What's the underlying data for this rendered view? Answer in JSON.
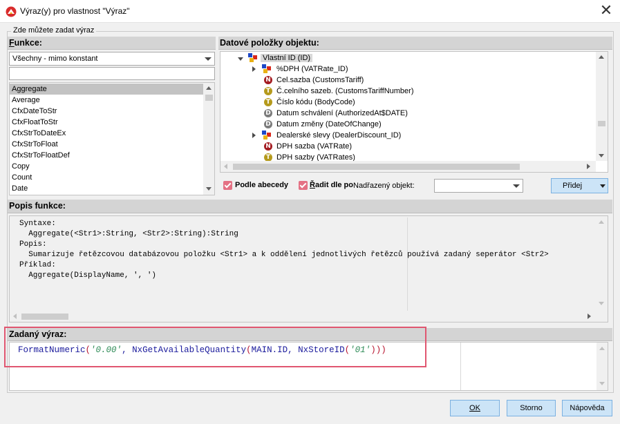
{
  "window": {
    "title": "Výraz(y) pro vlastnost \"Výraz\""
  },
  "group_label": "Zde můžete zadat výraz",
  "functions": {
    "header": "unkce:",
    "header_underlined": "F",
    "filter_value": "Všechny - mimo konstant",
    "search_value": "",
    "items": [
      "Aggregate",
      "Average",
      "CfxDateToStr",
      "CfxFloatToStr",
      "CfxStrToDateEx",
      "CfxStrToFloat",
      "CfxStrToFloatDef",
      "Copy",
      "Count",
      "Date"
    ],
    "selected": "Aggregate"
  },
  "data_items": {
    "header": "Datové položky objektu:",
    "root": {
      "label": "Vlastní ID (ID)",
      "icon": "object-icon"
    },
    "rows": [
      {
        "label": "%DPH  (VATRate_ID)",
        "icon": "object-icon",
        "expander": "closed"
      },
      {
        "label": "Cel.sazba  (CustomsTariff)",
        "icon": "N"
      },
      {
        "label": "Č.celního sazeb.  (CustomsTariffNumber)",
        "icon": "T"
      },
      {
        "label": "Číslo kódu  (BodyCode)",
        "icon": "T"
      },
      {
        "label": "Datum schválení  (AuthorizedAt$DATE)",
        "icon": "D"
      },
      {
        "label": "Datum změny  (DateOfChange)",
        "icon": "D"
      },
      {
        "label": "Dealerské slevy  (DealerDiscount_ID)",
        "icon": "object-icon",
        "expander": "closed"
      },
      {
        "label": "DPH sazba  (VATRate)",
        "icon": "N"
      },
      {
        "label": "DPH sazby  (VATRates)",
        "icon": "T"
      }
    ],
    "sort_alpha_label": "Podle abecedy",
    "sort_by_label_rest": "adit dle po",
    "sort_by_label_underlined": "Ř",
    "parent_object_label": "Nadřazený objekt:",
    "parent_object_value": "",
    "add_button": "Přidej"
  },
  "description": {
    "header": "Popis funkce:",
    "lines": [
      "Syntaxe:",
      "  Aggregate(<Str1>:String, <Str2>:String):String",
      "Popis:",
      "  Sumarizuje řetězcovou databázovou položku <Str1> a k oddělení jednotlivých řetězců používá zadaný seperátor <Str2>",
      "Příklad:",
      "  Aggregate(DisplayName, ', ')"
    ]
  },
  "expression": {
    "header": "Zadaný výraz:",
    "tokens": [
      {
        "t": "FormatNumeric",
        "k": "fn"
      },
      {
        "t": "(",
        "k": "paren"
      },
      {
        "t": "'0.00'",
        "k": "str"
      },
      {
        "t": ", ",
        "k": "fn"
      },
      {
        "t": "NxGetAvailableQuantity",
        "k": "fn"
      },
      {
        "t": "(",
        "k": "paren"
      },
      {
        "t": "MAIN.ID, ",
        "k": "fn"
      },
      {
        "t": "NxStoreID",
        "k": "fn"
      },
      {
        "t": "(",
        "k": "paren"
      },
      {
        "t": "'01'",
        "k": "str"
      },
      {
        "t": ")))",
        "k": "paren"
      }
    ]
  },
  "footer": {
    "ok_label": "OK",
    "cancel_label": "Storno",
    "help_label": "Nápověda"
  },
  "colors": {
    "accent_checkbox": "#e47184",
    "highlight_border": "#e05670",
    "function_token": "#1a1a9c",
    "string_token": "#2e8b57",
    "paren_token": "#b8142f"
  }
}
